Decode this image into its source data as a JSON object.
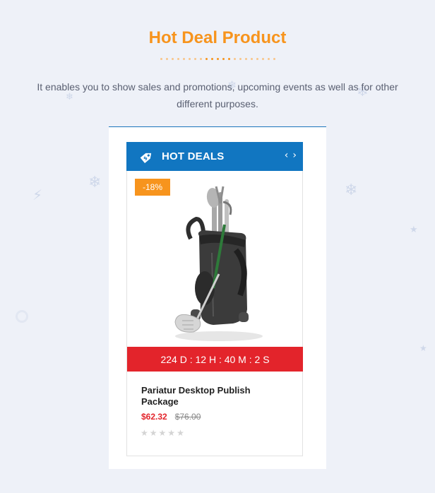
{
  "section": {
    "title": "Hot Deal Product",
    "subtitle_line1": "It enables you to show sales and promotions, upcoming events as well as for other",
    "subtitle_line2": "different purposes."
  },
  "widget": {
    "header_title": "HOT DEALS",
    "header_icon": "price-tag-icon",
    "prev_arrow": "‹",
    "next_arrow": "›"
  },
  "product": {
    "discount_badge": "-18%",
    "countdown": "224 D : 12 H : 40 M : 2 S",
    "name": "Pariatur Desktop Publish Package",
    "price_new": "$62.32",
    "price_old": "$76.00",
    "rating": 0,
    "rating_max": 5
  },
  "colors": {
    "accent_orange": "#f7941d",
    "header_blue": "#1176c1",
    "countdown_red": "#e3242b",
    "background": "#eef1f8"
  },
  "decorations": [
    "snowflake-icon",
    "snowflake-icon",
    "snowflake-icon",
    "snowflake-icon",
    "lightning-icon",
    "star-icon",
    "star-icon",
    "circle-icon"
  ]
}
